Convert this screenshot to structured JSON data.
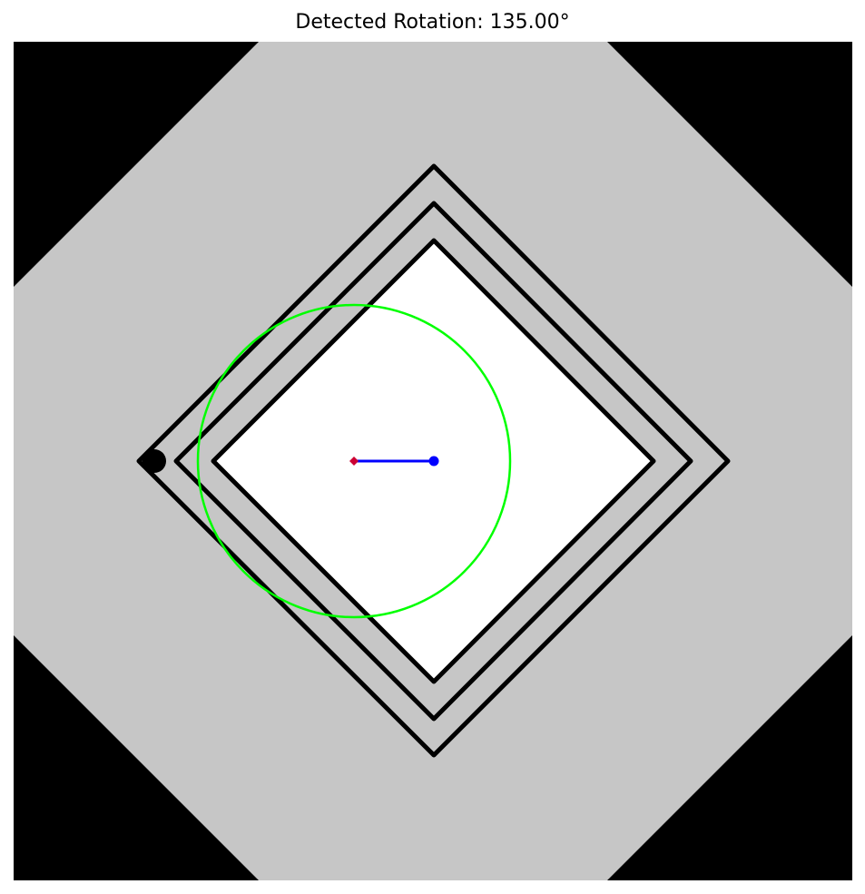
{
  "title": "Detected Rotation: 135.00°",
  "rotation": {
    "angle_deg": 135.0
  },
  "colors": {
    "background": "#000000",
    "rotated_square": "#c6c6c6",
    "inner_square": "#ffffff",
    "outlines": "#000000",
    "circle": "#00ff00",
    "vector": "#0000ff",
    "center_point": "#cc0033",
    "vector_tip": "#0000ff",
    "marker": "#000000"
  },
  "icons": {
    "orientation_marker": "filled-circle",
    "center_point": "diamond",
    "vector_tip": "filled-circle"
  }
}
